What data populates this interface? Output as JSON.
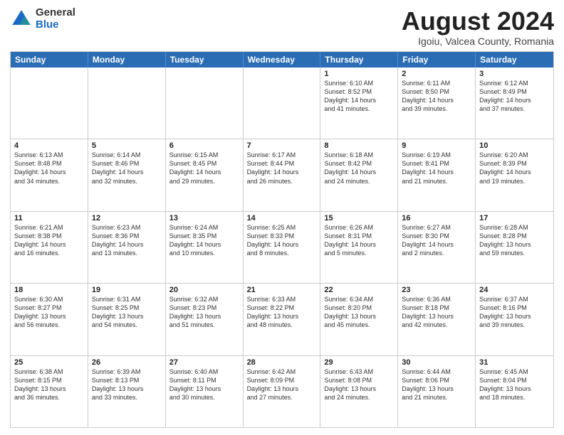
{
  "logo": {
    "general": "General",
    "blue": "Blue"
  },
  "header": {
    "month": "August 2024",
    "location": "Igoiu, Valcea County, Romania"
  },
  "days": [
    "Sunday",
    "Monday",
    "Tuesday",
    "Wednesday",
    "Thursday",
    "Friday",
    "Saturday"
  ],
  "weeks": [
    [
      {
        "day": "",
        "info": ""
      },
      {
        "day": "",
        "info": ""
      },
      {
        "day": "",
        "info": ""
      },
      {
        "day": "",
        "info": ""
      },
      {
        "day": "1",
        "info": "Sunrise: 6:10 AM\nSunset: 8:52 PM\nDaylight: 14 hours\nand 41 minutes."
      },
      {
        "day": "2",
        "info": "Sunrise: 6:11 AM\nSunset: 8:50 PM\nDaylight: 14 hours\nand 39 minutes."
      },
      {
        "day": "3",
        "info": "Sunrise: 6:12 AM\nSunset: 8:49 PM\nDaylight: 14 hours\nand 37 minutes."
      }
    ],
    [
      {
        "day": "4",
        "info": "Sunrise: 6:13 AM\nSunset: 8:48 PM\nDaylight: 14 hours\nand 34 minutes."
      },
      {
        "day": "5",
        "info": "Sunrise: 6:14 AM\nSunset: 8:46 PM\nDaylight: 14 hours\nand 32 minutes."
      },
      {
        "day": "6",
        "info": "Sunrise: 6:15 AM\nSunset: 8:45 PM\nDaylight: 14 hours\nand 29 minutes."
      },
      {
        "day": "7",
        "info": "Sunrise: 6:17 AM\nSunset: 8:44 PM\nDaylight: 14 hours\nand 26 minutes."
      },
      {
        "day": "8",
        "info": "Sunrise: 6:18 AM\nSunset: 8:42 PM\nDaylight: 14 hours\nand 24 minutes."
      },
      {
        "day": "9",
        "info": "Sunrise: 6:19 AM\nSunset: 8:41 PM\nDaylight: 14 hours\nand 21 minutes."
      },
      {
        "day": "10",
        "info": "Sunrise: 6:20 AM\nSunset: 8:39 PM\nDaylight: 14 hours\nand 19 minutes."
      }
    ],
    [
      {
        "day": "11",
        "info": "Sunrise: 6:21 AM\nSunset: 8:38 PM\nDaylight: 14 hours\nand 16 minutes."
      },
      {
        "day": "12",
        "info": "Sunrise: 6:23 AM\nSunset: 8:36 PM\nDaylight: 14 hours\nand 13 minutes."
      },
      {
        "day": "13",
        "info": "Sunrise: 6:24 AM\nSunset: 8:35 PM\nDaylight: 14 hours\nand 10 minutes."
      },
      {
        "day": "14",
        "info": "Sunrise: 6:25 AM\nSunset: 8:33 PM\nDaylight: 14 hours\nand 8 minutes."
      },
      {
        "day": "15",
        "info": "Sunrise: 6:26 AM\nSunset: 8:31 PM\nDaylight: 14 hours\nand 5 minutes."
      },
      {
        "day": "16",
        "info": "Sunrise: 6:27 AM\nSunset: 8:30 PM\nDaylight: 14 hours\nand 2 minutes."
      },
      {
        "day": "17",
        "info": "Sunrise: 6:28 AM\nSunset: 8:28 PM\nDaylight: 13 hours\nand 59 minutes."
      }
    ],
    [
      {
        "day": "18",
        "info": "Sunrise: 6:30 AM\nSunset: 8:27 PM\nDaylight: 13 hours\nand 56 minutes."
      },
      {
        "day": "19",
        "info": "Sunrise: 6:31 AM\nSunset: 8:25 PM\nDaylight: 13 hours\nand 54 minutes."
      },
      {
        "day": "20",
        "info": "Sunrise: 6:32 AM\nSunset: 8:23 PM\nDaylight: 13 hours\nand 51 minutes."
      },
      {
        "day": "21",
        "info": "Sunrise: 6:33 AM\nSunset: 8:22 PM\nDaylight: 13 hours\nand 48 minutes."
      },
      {
        "day": "22",
        "info": "Sunrise: 6:34 AM\nSunset: 8:20 PM\nDaylight: 13 hours\nand 45 minutes."
      },
      {
        "day": "23",
        "info": "Sunrise: 6:36 AM\nSunset: 8:18 PM\nDaylight: 13 hours\nand 42 minutes."
      },
      {
        "day": "24",
        "info": "Sunrise: 6:37 AM\nSunset: 8:16 PM\nDaylight: 13 hours\nand 39 minutes."
      }
    ],
    [
      {
        "day": "25",
        "info": "Sunrise: 6:38 AM\nSunset: 8:15 PM\nDaylight: 13 hours\nand 36 minutes."
      },
      {
        "day": "26",
        "info": "Sunrise: 6:39 AM\nSunset: 8:13 PM\nDaylight: 13 hours\nand 33 minutes."
      },
      {
        "day": "27",
        "info": "Sunrise: 6:40 AM\nSunset: 8:11 PM\nDaylight: 13 hours\nand 30 minutes."
      },
      {
        "day": "28",
        "info": "Sunrise: 6:42 AM\nSunset: 8:09 PM\nDaylight: 13 hours\nand 27 minutes."
      },
      {
        "day": "29",
        "info": "Sunrise: 6:43 AM\nSunset: 8:08 PM\nDaylight: 13 hours\nand 24 minutes."
      },
      {
        "day": "30",
        "info": "Sunrise: 6:44 AM\nSunset: 8:06 PM\nDaylight: 13 hours\nand 21 minutes."
      },
      {
        "day": "31",
        "info": "Sunrise: 6:45 AM\nSunset: 8:04 PM\nDaylight: 13 hours\nand 18 minutes."
      }
    ]
  ]
}
